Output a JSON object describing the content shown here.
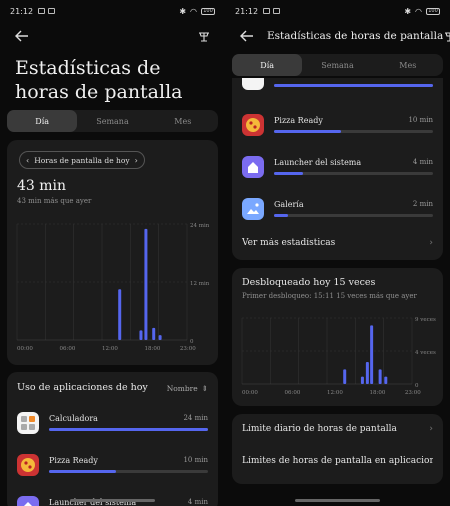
{
  "status": {
    "time": "21:12",
    "battery": "100"
  },
  "left": {
    "title": "Estadísticas de horas de pantalla",
    "tabs": [
      "Día",
      "Semana",
      "Mes"
    ],
    "active_tab": 0,
    "chart_card": {
      "pill_label": "Horas de pantalla de hoy",
      "total": "43 min",
      "subtitle": "43 min más que ayer"
    },
    "usage": {
      "header": "Uso de aplicaciones de hoy",
      "sort": "Nombre",
      "apps": [
        {
          "name": "Calculadora",
          "time": "24 min",
          "fraction": 1.0
        },
        {
          "name": "Pizza Ready",
          "time": "10 min",
          "fraction": 0.42
        },
        {
          "name": "Launcher del sistema",
          "time": "4 min",
          "fraction": 0.18
        }
      ]
    }
  },
  "right": {
    "title": "Estadísticas de horas de pantalla",
    "tabs": [
      "Día",
      "Semana",
      "Mes"
    ],
    "active_tab": 0,
    "apps": [
      {
        "name": "Calculadora",
        "time": "24 min",
        "fraction": 1.0
      },
      {
        "name": "Pizza Ready",
        "time": "10 min",
        "fraction": 0.42
      },
      {
        "name": "Launcher del sistema",
        "time": "4 min",
        "fraction": 0.18
      },
      {
        "name": "Galería",
        "time": "2 min",
        "fraction": 0.09
      }
    ],
    "more_stats": "Ver más estadísticas",
    "unlock": {
      "title": "Desbloqueado hoy 15 veces",
      "subtitle": "Primer desbloqueo: 15:11 15 veces más que ayer"
    },
    "limit1": "Límite diario de horas de pantalla",
    "limit2": "Límites de horas de pantalla en aplicaciones"
  },
  "chart_data": [
    {
      "type": "bar",
      "x_ticks": [
        "00:00",
        "06:00",
        "12:00",
        "18:00",
        "23:00"
      ],
      "y_ticks": [
        "24 min",
        "12 min",
        "0"
      ],
      "ylim": [
        0,
        24
      ],
      "bars": [
        {
          "hour": 14.5,
          "value": 10.5
        },
        {
          "hour": 17.5,
          "value": 2
        },
        {
          "hour": 18.2,
          "value": 23
        },
        {
          "hour": 19.3,
          "value": 2.5
        },
        {
          "hour": 20.2,
          "value": 1
        }
      ]
    },
    {
      "type": "bar",
      "x_ticks": [
        "00:00",
        "06:00",
        "12:00",
        "18:00",
        "23:00"
      ],
      "y_ticks": [
        "9 veces",
        "4 veces",
        "0"
      ],
      "ylim": [
        0,
        9
      ],
      "bars": [
        {
          "hour": 14.5,
          "value": 2
        },
        {
          "hour": 17.0,
          "value": 1
        },
        {
          "hour": 17.7,
          "value": 3
        },
        {
          "hour": 18.3,
          "value": 8
        },
        {
          "hour": 19.5,
          "value": 2
        },
        {
          "hour": 20.3,
          "value": 1
        }
      ]
    }
  ]
}
